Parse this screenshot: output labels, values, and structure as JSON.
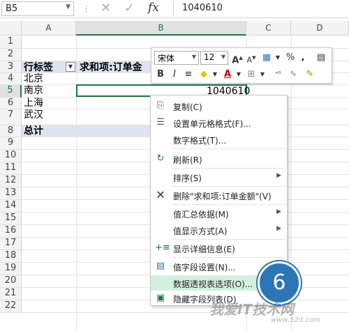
{
  "formula_bar": {
    "name_box": "B5",
    "cancel_icon": "cancel-icon",
    "enter_icon": "check-icon",
    "fx_label": "fx",
    "value": "1040610"
  },
  "columns": [
    "A",
    "B",
    "C",
    "D"
  ],
  "rows": [
    "1",
    "2",
    "3",
    "4",
    "5",
    "6",
    "7",
    "8",
    "9",
    "10",
    "11",
    "12",
    "13",
    "14",
    "15",
    "16",
    "17",
    "18",
    "19",
    "20",
    "21",
    "22"
  ],
  "cells": {
    "a3": "行标签",
    "b3": "求和项:订单金",
    "a4": "北京",
    "a5": "南京",
    "a6": "上海",
    "a7": "武汉",
    "a8": "总计",
    "b5": "1040610"
  },
  "mini_toolbar": {
    "font": "宋体",
    "size": "12",
    "bold": "B",
    "italic": "I",
    "align": "≡",
    "font_color": "A",
    "percent": "%",
    "comma": ",",
    "grow": "A",
    "shrink": "A"
  },
  "context_menu": {
    "items": [
      {
        "label": "复制(C)",
        "icon": "copy-icon"
      },
      {
        "label": "设置单元格格式(F)...",
        "icon": "format-cells-icon"
      },
      {
        "label": "数字格式(T)...",
        "icon": ""
      },
      {
        "label": "刷新(R)",
        "icon": "refresh-icon"
      },
      {
        "label": "排序(S)",
        "icon": "",
        "submenu": true
      },
      {
        "label": "删除\"求和项:订单金额\"(V)",
        "icon": "delete-icon"
      },
      {
        "label": "值汇总依据(M)",
        "icon": "",
        "submenu": true
      },
      {
        "label": "值显示方式(A)",
        "icon": "",
        "submenu": true
      },
      {
        "label": "显示详细信息(E)",
        "icon": "show-details-icon"
      },
      {
        "label": "值字段设置(N)...",
        "icon": "field-settings-icon"
      },
      {
        "label": "数据透视表选项(O)...",
        "icon": ""
      },
      {
        "label": "隐藏字段列表(D)",
        "icon": "field-list-icon"
      }
    ]
  },
  "step_badge": "6",
  "watermark": {
    "text": "我爱IT技术网",
    "url": "www.52it.com"
  },
  "colors": {
    "accent": "#217346",
    "highlight": "#d3f0e0",
    "badge": "#2e75b6"
  }
}
